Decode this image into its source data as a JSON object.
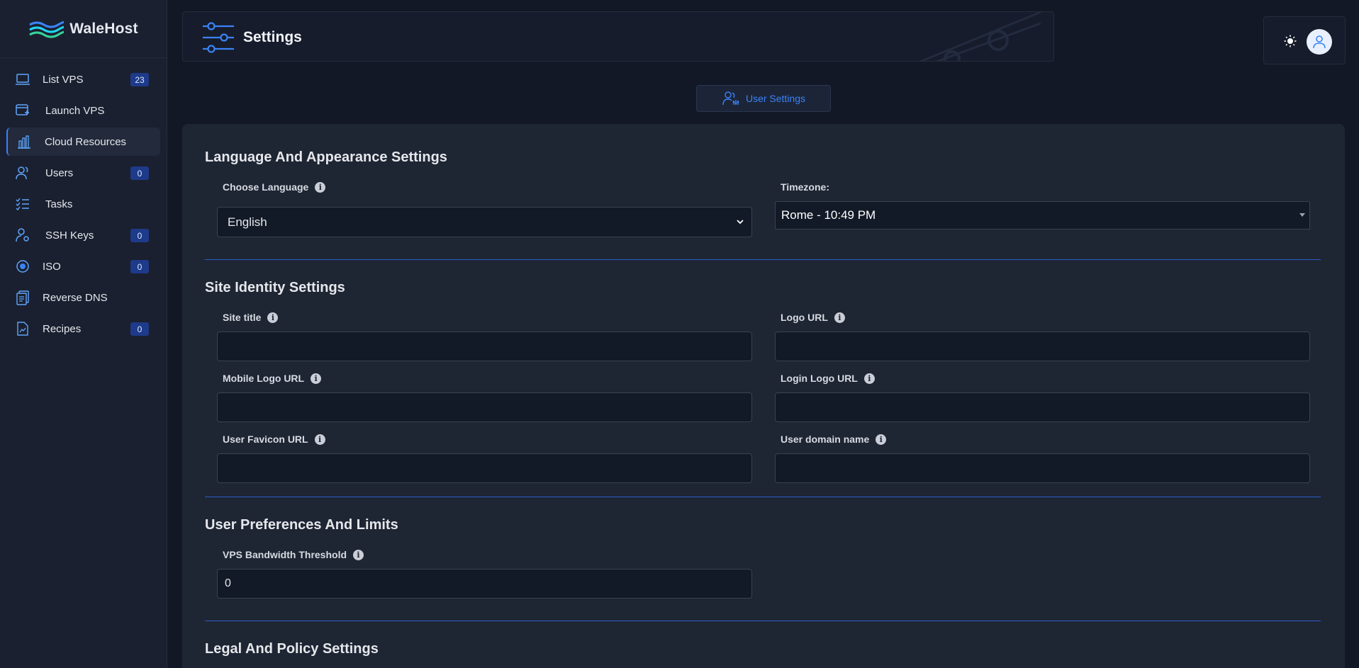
{
  "app": {
    "brand": "WaleHost"
  },
  "sidebar": {
    "items": [
      {
        "label": "List VPS",
        "badge": "23",
        "icon": "laptop-icon"
      },
      {
        "label": "Launch VPS",
        "badge": null,
        "icon": "launch-icon"
      },
      {
        "label": "Cloud Resources",
        "badge": null,
        "icon": "bar-chart-icon"
      },
      {
        "label": "Users",
        "badge": "0",
        "icon": "users-icon"
      },
      {
        "label": "Tasks",
        "badge": null,
        "icon": "tasks-icon"
      },
      {
        "label": "SSH Keys",
        "badge": "0",
        "icon": "key-user-icon"
      },
      {
        "label": "ISO",
        "badge": "0",
        "icon": "disc-icon"
      },
      {
        "label": "Reverse DNS",
        "badge": null,
        "icon": "documents-icon"
      },
      {
        "label": "Recipes",
        "badge": "0",
        "icon": "file-chart-icon"
      }
    ]
  },
  "header": {
    "title": "Settings"
  },
  "tabs": {
    "user_settings": "User Settings"
  },
  "sections": {
    "language": {
      "title": "Language And Appearance Settings",
      "choose_language_label": "Choose Language",
      "language_value": "English",
      "timezone_label": "Timezone:",
      "timezone_value": "Rome - 10:49 PM"
    },
    "identity": {
      "title": "Site Identity Settings",
      "site_title_label": "Site title",
      "site_title_value": "",
      "logo_url_label": "Logo URL",
      "logo_url_value": "",
      "mobile_logo_label": "Mobile Logo URL",
      "mobile_logo_value": "",
      "login_logo_label": "Login Logo URL",
      "login_logo_value": "",
      "favicon_label": "User Favicon URL",
      "favicon_value": "",
      "domain_label": "User domain name",
      "domain_value": ""
    },
    "preferences": {
      "title": "User Preferences And Limits",
      "bandwidth_label": "VPS Bandwidth Threshold",
      "bandwidth_value": "0"
    },
    "legal": {
      "title": "Legal And Policy Settings"
    }
  },
  "colors": {
    "accent": "#3b82f6",
    "background": "#131826",
    "panel": "#1e2533",
    "badge": "#1e3a8a"
  }
}
